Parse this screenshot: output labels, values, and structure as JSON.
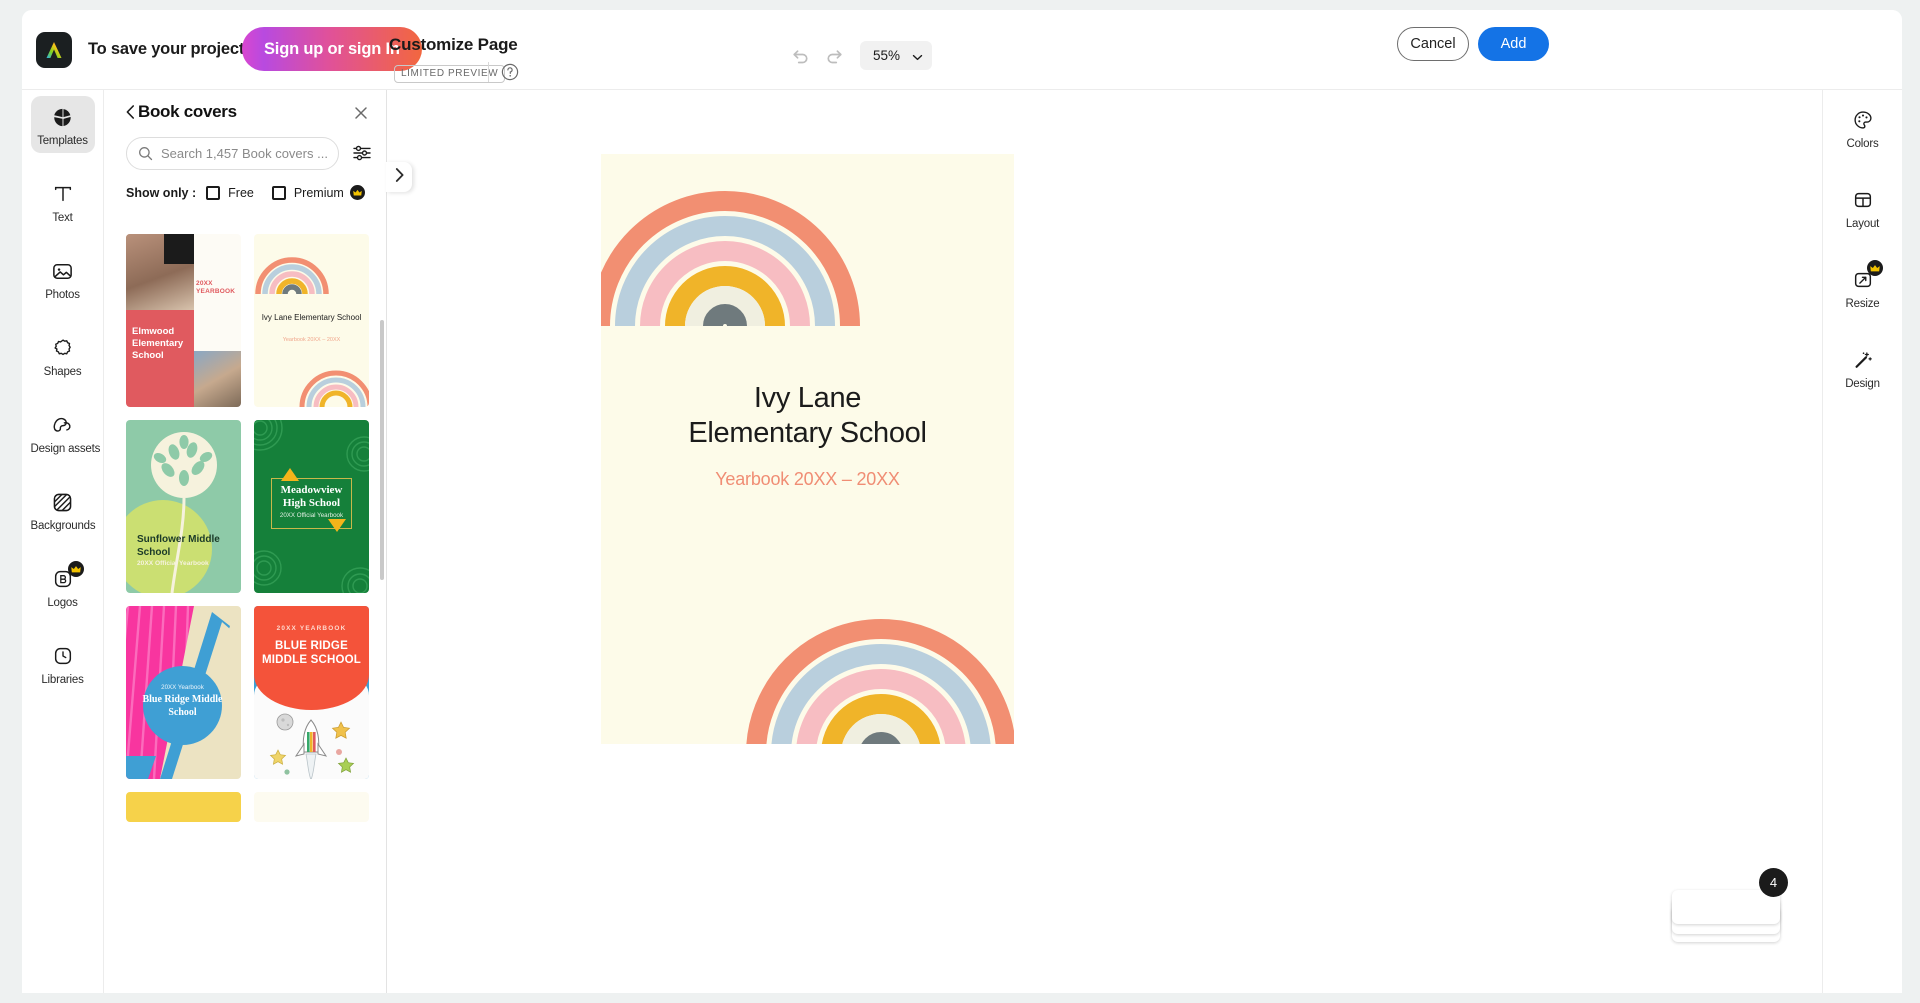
{
  "topbar": {
    "logo_icon": "adobe-express-logo-icon",
    "save_prompt": "To save your project",
    "signup_label": "Sign up or sign In",
    "doc_title": "Customize Page",
    "limited_preview_badge": "LIMITED PREVIEW",
    "help_icon": "question-mark-circle-icon",
    "undo_icon": "undo-arrow-icon",
    "redo_icon": "redo-arrow-icon",
    "zoom_value": "55%",
    "zoom_caret_icon": "chevron-down-icon",
    "cancel_label": "Cancel",
    "add_label": "Add",
    "accent_blue": "#1473e6"
  },
  "left_rail": {
    "items": [
      {
        "label": "Templates",
        "icon": "templates-icon",
        "active": true,
        "premium": false
      },
      {
        "label": "Text",
        "icon": "text-t-icon",
        "active": false,
        "premium": false
      },
      {
        "label": "Photos",
        "icon": "photo-image-icon",
        "active": false,
        "premium": false
      },
      {
        "label": "Shapes",
        "icon": "shapes-starburst-icon",
        "active": false,
        "premium": false
      },
      {
        "label": "Design assets",
        "icon": "design-assets-icon",
        "active": false,
        "premium": false
      },
      {
        "label": "Backgrounds",
        "icon": "backgrounds-hatch-icon",
        "active": false,
        "premium": false
      },
      {
        "label": "Logos",
        "icon": "logos-brand-icon",
        "active": false,
        "premium": true
      },
      {
        "label": "Libraries",
        "icon": "libraries-clock-icon",
        "active": false,
        "premium": false
      }
    ]
  },
  "panel": {
    "back_icon": "chevron-left-icon",
    "title": "Book covers",
    "close_icon": "close-x-icon",
    "search_icon": "search-icon",
    "search_value": "",
    "search_placeholder": "Search 1,457 Book covers ...",
    "filter_icon": "filter-sliders-icon",
    "show_only_label": "Show only :",
    "filters": [
      {
        "label": "Free",
        "checked": false,
        "premium": false
      },
      {
        "label": "Premium",
        "checked": false,
        "premium": true
      }
    ],
    "collapse_icon": "chevron-right-icon",
    "templates": [
      {
        "name": "Elmwood Elementary School",
        "kicker": "20XX YEARBOOK",
        "style": "elmwood"
      },
      {
        "name": "Ivy Lane Elementary School",
        "kicker": "Yearbook 20XX – 20XX",
        "style": "ivylane"
      },
      {
        "name": "Sunflower Middle School",
        "kicker": "20XX Official Yearbook",
        "style": "sunflower"
      },
      {
        "name": "Meadowview High School",
        "kicker": "20XX Official Yearbook",
        "style": "meadowview"
      },
      {
        "name": "Blue Ridge Middle School",
        "kicker": "20XX Yearbook",
        "style": "blueridge-pink"
      },
      {
        "name": "BLUE RIDGE MIDDLE SCHOOL",
        "kicker": "20XX YEARBOOK",
        "style": "blueridge-red"
      }
    ]
  },
  "canvas": {
    "page_title_line1": "Ivy Lane",
    "page_title_line2": "Elementary School",
    "page_subtitle": "Yearbook 20XX – 20XX",
    "page_background": "#fdfbe9",
    "subtitle_color": "#f08d74",
    "rainbow_colors": [
      "#f28f72",
      "#b9cfdd",
      "#f7bdc2",
      "#f0b429",
      "#f0efe0",
      "#6f7a7d"
    ],
    "page_count_badge": "4"
  },
  "right_rail": {
    "items": [
      {
        "label": "Colors",
        "icon": "palette-icon",
        "premium": false
      },
      {
        "label": "Layout",
        "icon": "layout-grid-icon",
        "premium": false
      },
      {
        "label": "Resize",
        "icon": "resize-arrows-icon",
        "premium": true
      },
      {
        "label": "Design",
        "icon": "magic-wand-icon",
        "premium": false
      }
    ]
  }
}
